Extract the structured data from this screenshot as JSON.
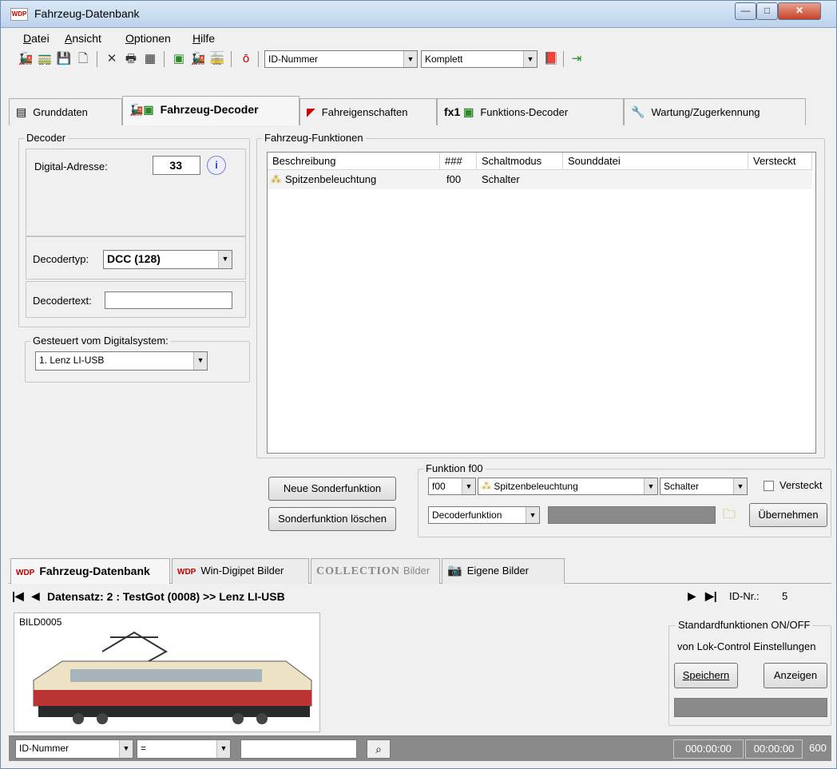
{
  "window": {
    "title": "Fahrzeug-Datenbank",
    "icon": "wdp-app-icon",
    "min": "—",
    "max": "□",
    "close": "✕"
  },
  "menu": [
    "Datei",
    "Ansicht",
    "Optionen",
    "Hilfe"
  ],
  "toolbar": {
    "sort_combo": "ID-Nummer",
    "view_combo": "Komplett"
  },
  "tabs": [
    {
      "label": "Grunddaten",
      "icon": "document-icon"
    },
    {
      "label": "Fahrzeug-Decoder",
      "icon": "locomotive-decoder-icon"
    },
    {
      "label": "Fahreigenschaften",
      "icon": "speed-curve-icon"
    },
    {
      "label": "Funktions-Decoder",
      "icon": "fx1-decoder-icon"
    },
    {
      "label": "Wartung/Zugerkennung",
      "icon": "wrench-icon"
    }
  ],
  "decoder": {
    "group_title": "Decoder",
    "address_label": "Digital-Adresse:",
    "address_value": "33",
    "type_label": "Decodertyp:",
    "type_value": "DCC (128)",
    "text_label": "Decodertext:",
    "text_value": ""
  },
  "digitalsystem": {
    "group_title": "Gesteuert vom Digitalsystem:",
    "value": "1. Lenz LI-USB"
  },
  "functions": {
    "group_title": "Fahrzeug-Funktionen",
    "columns": [
      "Beschreibung",
      "###",
      "Schaltmodus",
      "Sounddatei",
      "Versteckt"
    ],
    "rows": [
      {
        "beschreibung": "Spitzenbeleuchtung",
        "nr": "f00",
        "modus": "Schalter",
        "sound": "",
        "versteckt": ""
      }
    ]
  },
  "buttons": {
    "new": "Neue Sonderfunktion",
    "delete": "Sonderfunktion löschen",
    "apply": "Übernehmen"
  },
  "funktion": {
    "group_title": "Funktion f00",
    "nr": "f00",
    "description": "Spitzenbeleuchtung",
    "mode": "Schalter",
    "hidden_label": "Versteckt",
    "type": "Decoderfunktion"
  },
  "lower_tabs": [
    "Fahrzeug-Datenbank",
    "Win-Digipet Bilder",
    "Bilder",
    "Eigene Bilder"
  ],
  "collection_label": "COLLECTION",
  "record": {
    "label": "Datensatz: 2 : TestGot  (0008) >> Lenz LI-USB",
    "id_label": "ID-Nr.:",
    "id_value": "5"
  },
  "image": {
    "caption": "BILD0005"
  },
  "standard": {
    "title": "Standardfunktionen ON/OFF",
    "subtitle": "von Lok-Control Einstellungen",
    "save": "Speichern",
    "show": "Anzeigen"
  },
  "statusbar": {
    "field1": "ID-Nummer",
    "field2": "=",
    "field3": "",
    "time1": "000:00:00",
    "time2": "00:00:00",
    "count": "600"
  }
}
